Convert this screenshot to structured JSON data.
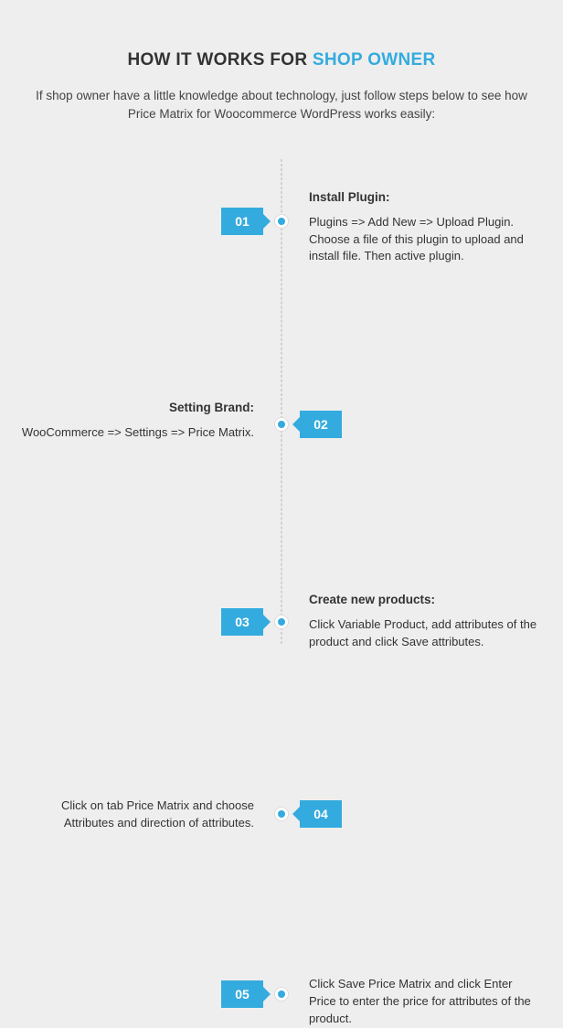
{
  "title_prefix": "HOW IT WORKS FOR ",
  "title_accent": "SHOP OWNER",
  "subtitle": "If shop owner have a little knowledge about technology, just follow steps below to see how Price Matrix for Woocommerce WordPress works easily:",
  "steps": [
    {
      "num": "01",
      "heading": "Install Plugin:",
      "body": "Plugins => Add New => Upload Plugin. Choose a file of this plugin to upload and install file. Then active plugin."
    },
    {
      "num": "02",
      "heading": "Setting Brand:",
      "body": "WooCommerce => Settings => Price Matrix."
    },
    {
      "num": "03",
      "heading": "Create new products:",
      "body": "Click Variable Product, add attributes of the product and click Save attributes."
    },
    {
      "num": "04",
      "heading": "",
      "body": "Click on tab Price Matrix and choose Attributes and direction of attributes."
    },
    {
      "num": "05",
      "heading": "",
      "body": "Click Save Price Matrix and click Enter Price to enter the price for attributes of the product."
    }
  ]
}
